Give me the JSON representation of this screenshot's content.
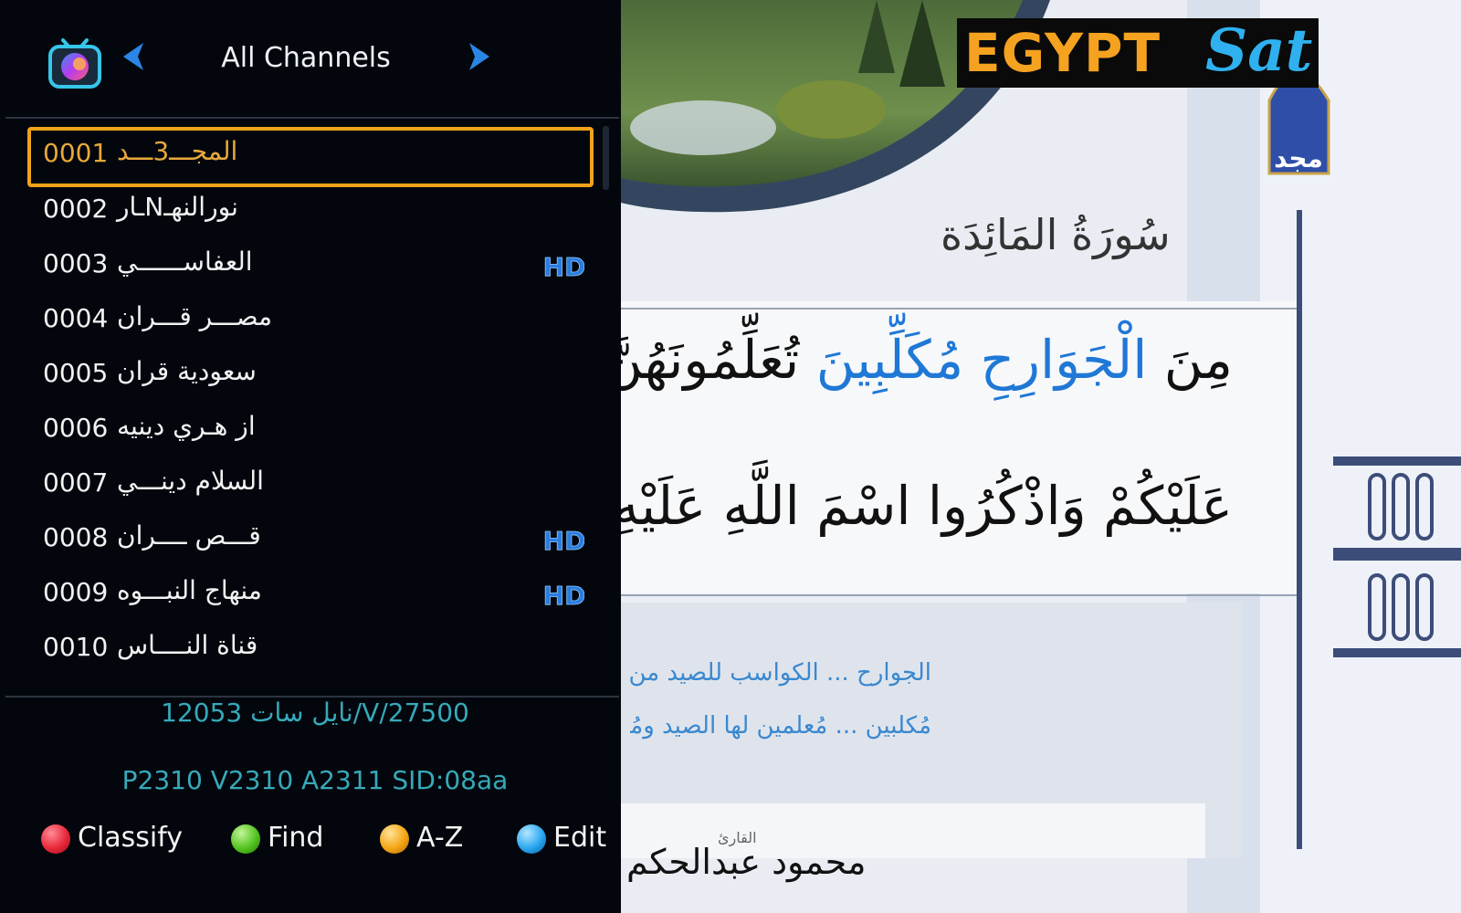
{
  "header": {
    "title": "All Channels",
    "icon": "tv-icon",
    "prev_icon": "arrow-left-icon",
    "next_icon": "arrow-right-icon"
  },
  "channels": [
    {
      "number": "0001",
      "name": "المجـــ3ـــد",
      "hd": false,
      "selected": true
    },
    {
      "number": "0002",
      "name": "نورالنهـNـار",
      "hd": false,
      "selected": false
    },
    {
      "number": "0003",
      "name": "العفاســــــي",
      "hd": true,
      "selected": false
    },
    {
      "number": "0004",
      "name": "مصـــر قـــران",
      "hd": false,
      "selected": false
    },
    {
      "number": "0005",
      "name": "سعودية قران",
      "hd": false,
      "selected": false
    },
    {
      "number": "0006",
      "name": "از هـري دينيه",
      "hd": false,
      "selected": false
    },
    {
      "number": "0007",
      "name": "السلام دينـــي",
      "hd": false,
      "selected": false
    },
    {
      "number": "0008",
      "name": "قـــص ــــران",
      "hd": true,
      "selected": false
    },
    {
      "number": "0009",
      "name": "منهاج النبـــوه",
      "hd": true,
      "selected": false
    },
    {
      "number": "0010",
      "name": "قناة النــــاس",
      "hd": false,
      "selected": false
    }
  ],
  "hd_badge": "HD",
  "info": {
    "transponder": "نايل سات 12053/V/27500",
    "pids": "P2310 V2310 A2311 SID:08aa"
  },
  "keys": [
    {
      "label": "Classify",
      "color": "#e8283a"
    },
    {
      "label": "Find",
      "color": "#53c41f"
    },
    {
      "label": "A-Z",
      "color": "#f5a515"
    },
    {
      "label": "Edit",
      "color": "#2aa6f0"
    }
  ],
  "overlay": {
    "logo_primary": "EGYPT",
    "logo_secondary": "Sat"
  },
  "video": {
    "surah_title": "سُورَةُ المَائِدَة",
    "verse1_black": "مِنَ",
    "verse1_blue": "الْجَوَارِحِ مُكَلِّبِينَ",
    "verse1_rest": "تُعَلِّمُونَهُنَّ مِمَّا عَلَّمَكُمُ",
    "verse2": "عَلَيْكُمْ وَاذْكُرُوا اسْمَ اللَّهِ عَلَيْهِ وَاتَّقُوا اللَّهَ",
    "note1": "الجوارح ... الكواسب للصيد من السباع",
    "note2": "مُكلبين ... مُعلمين لها الصيد ومُضرين",
    "reciter_label": "القارئ",
    "reciter": "محمود عبدالحكم",
    "channel_logo_text": "مجد"
  },
  "colors": {
    "panel_bg": "#03070d",
    "selection": "#f0a21c",
    "info_text": "#37a9b9",
    "hd_badge": "#2a7de0"
  }
}
